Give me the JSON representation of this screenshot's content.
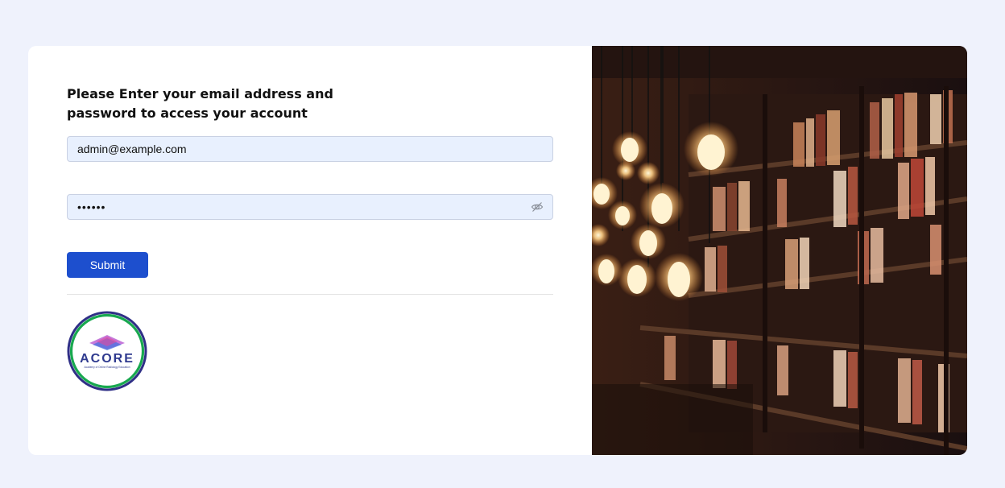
{
  "login": {
    "heading": "Please Enter your email address and password to access your account",
    "email_value": "admin@example.com",
    "password_value": "••••••",
    "submit_label": "Submit",
    "toggle_icon": "eye-slash-icon"
  },
  "logo": {
    "wordmark": "ACORE",
    "tagline": "Academy of Online Radiology Education"
  },
  "colors": {
    "page_background": "#eff2fc",
    "primary_button": "#1d4fce",
    "input_background": "#e8f0fe",
    "logo_ring": "#18a84f"
  }
}
